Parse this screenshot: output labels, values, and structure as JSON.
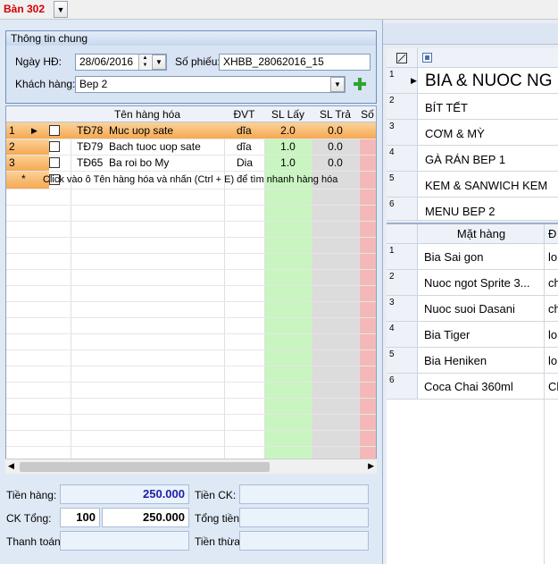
{
  "top": {
    "table_label": "Bàn 302"
  },
  "general": {
    "title": "Thông tin chung",
    "date_label": "Ngày HĐ:",
    "date_value": "28/06/2016",
    "voucher_label": "Số phiếu:",
    "voucher_value": "XHBB_28062016_15",
    "customer_label": "Khách hàng:",
    "customer_value": "Bep 2"
  },
  "grid": {
    "headers": [
      "Tên hàng hóa",
      "ĐVT",
      "SL Lấy",
      "SL Trả",
      "Số"
    ],
    "rows": [
      {
        "num": "1",
        "code": "TĐ78",
        "name": "Muc uop sate",
        "unit": "dĩa",
        "qty": "2.0",
        "ret": "0.0"
      },
      {
        "num": "2",
        "code": "TĐ79",
        "name": "Bach tuoc uop  sate",
        "unit": "dĩa",
        "qty": "1.0",
        "ret": "0.0"
      },
      {
        "num": "3",
        "code": "TĐ65",
        "name": "Ba roi bo My",
        "unit": "Dia",
        "qty": "1.0",
        "ret": "0.0"
      }
    ],
    "new_row_marker": "*",
    "hint": "Click vào ô Tên hàng hóa và nhấn (Ctrl + E) để tìm nhanh hàng hóa"
  },
  "totals": {
    "subtotal_label": "Tiền hàng:",
    "subtotal_value": "250.000",
    "discount_label": "Tiền CK:",
    "discount_value": "",
    "ck_total_label": "CK Tổng:",
    "ck_percent": "100",
    "ck_total_value": "250.000",
    "total_label": "Tổng tiền:",
    "total_value": "",
    "paid_label": "Thanh toán:",
    "paid_value": "",
    "change_label": "Tiền thừa:",
    "change_value": ""
  },
  "categories": [
    {
      "num": "1",
      "name": "BIA & NUOC NG"
    },
    {
      "num": "2",
      "name": "BÍT TẾT"
    },
    {
      "num": "3",
      "name": "CƠM & MỲ"
    },
    {
      "num": "4",
      "name": "GÀ RÁN BEP 1"
    },
    {
      "num": "5",
      "name": "KEM & SANWICH KEM"
    },
    {
      "num": "6",
      "name": "MENU BEP 2"
    }
  ],
  "items": {
    "header_name": "Mặt hàng",
    "header_unit": "Đ",
    "rows": [
      {
        "num": "1",
        "name": "Bia Sai gon",
        "unit": "lo"
      },
      {
        "num": "2",
        "name": "Nuoc ngot Sprite 3...",
        "unit": "ch"
      },
      {
        "num": "3",
        "name": "Nuoc suoi Dasani",
        "unit": "ch"
      },
      {
        "num": "4",
        "name": "Bia Tiger",
        "unit": "lo"
      },
      {
        "num": "5",
        "name": "Bia Heniken",
        "unit": "lo"
      },
      {
        "num": "6",
        "name": "Coca Chai 360ml",
        "unit": "Ch"
      }
    ]
  },
  "colors": {
    "accent_orange": "#f7b76a",
    "qty_green": "#c8f5c0",
    "ret_gray": "#dcdcdc",
    "so_pink": "#f5b8b8",
    "title_red": "#d40000"
  }
}
